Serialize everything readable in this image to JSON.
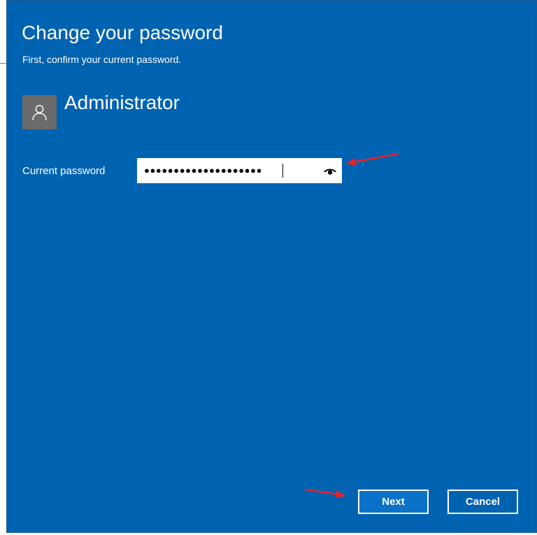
{
  "dialog": {
    "title": "Change your password",
    "subtitle": "First, confirm your current password."
  },
  "account": {
    "username": "Administrator",
    "avatar_icon": "user-icon"
  },
  "password_field": {
    "label": "Current password",
    "masked_value": "●●●●●●●●●●●●●●●●●●●●",
    "reveal_icon": "eye-icon"
  },
  "buttons": {
    "next_label": "Next",
    "cancel_label": "Cancel"
  },
  "colors": {
    "dialog_background": "#0063b1",
    "primary_button": "#0a72c9",
    "avatar_background": "#6b6b6b",
    "annotation_arrow": "#e8212b"
  },
  "annotations": {
    "arrow_icon": "red-arrow-icon"
  }
}
